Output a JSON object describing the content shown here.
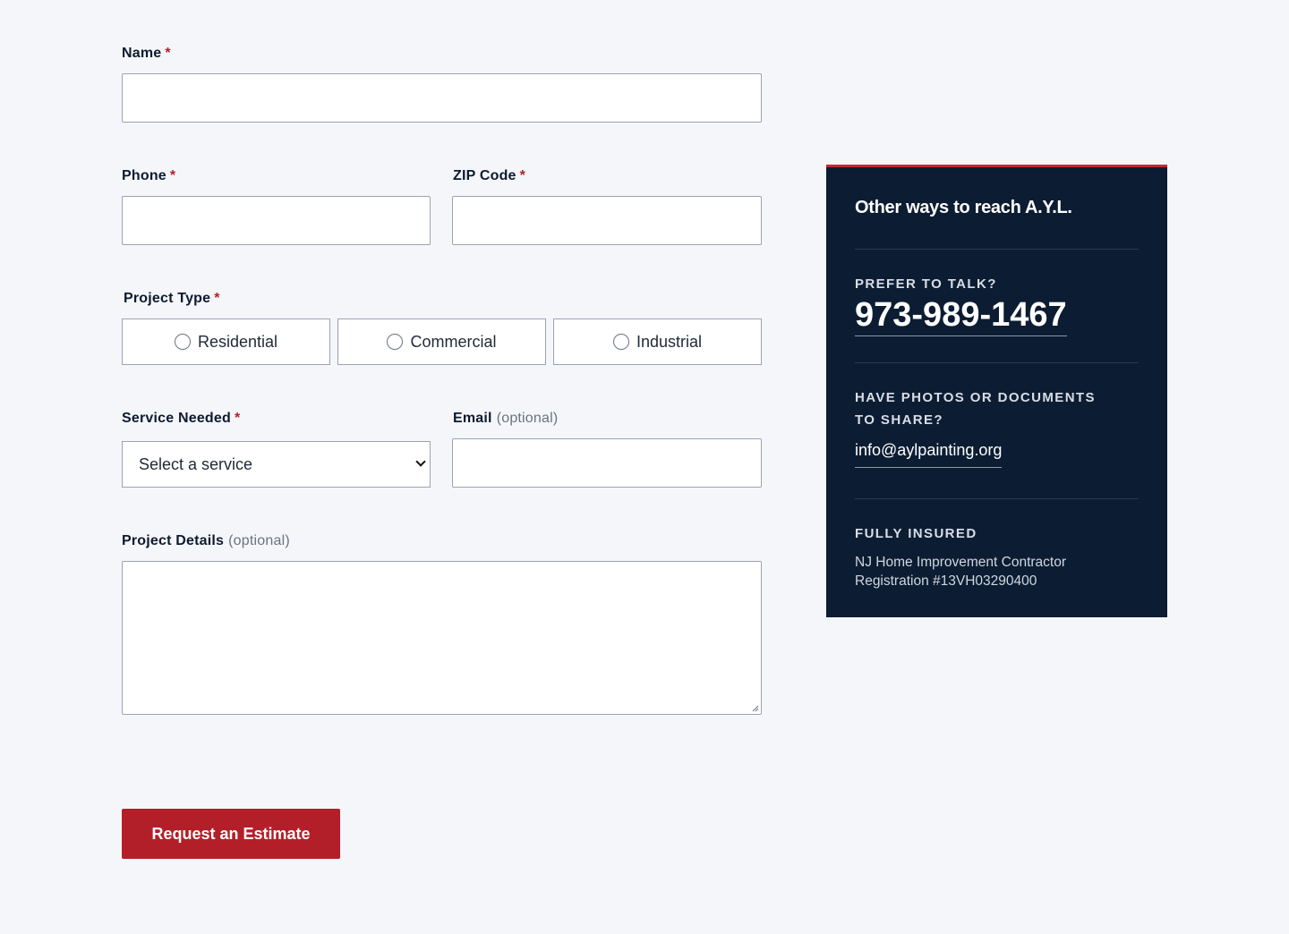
{
  "form": {
    "name": {
      "label": "Name",
      "required_mark": "*"
    },
    "phone": {
      "label": "Phone",
      "required_mark": "*"
    },
    "zip": {
      "label": "ZIP Code",
      "required_mark": "*"
    },
    "project_type": {
      "label": "Project Type",
      "required_mark": "*",
      "options": [
        "Residential",
        "Commercial",
        "Industrial"
      ]
    },
    "service": {
      "label": "Service Needed",
      "required_mark": "*",
      "selected": "Select a service"
    },
    "email": {
      "label": "Email",
      "optional": "(optional)"
    },
    "details": {
      "label": "Project Details",
      "optional": "(optional)"
    },
    "submit_label": "Request an Estimate"
  },
  "contact_card": {
    "title": "Other ways to reach A.Y.L.",
    "talk_heading": "PREFER TO TALK?",
    "phone": "973-989-1467",
    "photos_heading": "HAVE PHOTOS OR DOCUMENTS TO SHARE?",
    "email": "info@aylpainting.org",
    "insured_heading": "FULLY INSURED",
    "insured_text": "NJ Home Improvement Contractor Registration #13VH03290400"
  },
  "colors": {
    "accent": "#b31f28",
    "card_bg": "#0c1d33",
    "page_bg": "#f5f6fa"
  }
}
